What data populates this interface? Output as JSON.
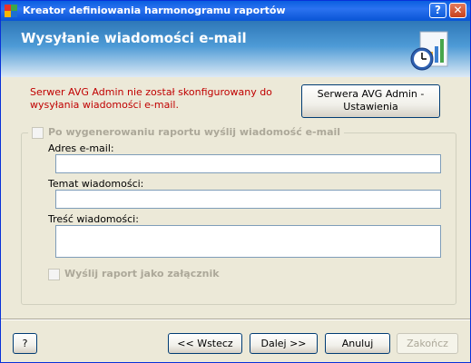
{
  "window": {
    "title": "Kreator definiowania harmonogramu raportów",
    "help_button": "?",
    "close_button": "✕"
  },
  "banner": {
    "title": "Wysyłanie wiadomości e-mail",
    "icon": "clock-chart-icon"
  },
  "warning": {
    "text": "Serwer AVG Admin nie został skonfigurowany do wysyłania wiadomości e-mail."
  },
  "settings_button": {
    "line1": "Serwera AVG Admin -",
    "line2": "Ustawienia"
  },
  "email_group": {
    "checkbox_label": "Po wygenerowaniu raportu wyślij wiadomość e-mail",
    "checked": false,
    "address_label": "Adres e-mail:",
    "address_value": "",
    "subject_label": "Temat wiadomości:",
    "subject_value": "",
    "body_label": "Treść wiadomości:",
    "body_value": "",
    "attach_label": "Wyślij raport jako załącznik",
    "attach_checked": false
  },
  "footer": {
    "help": "?",
    "back": "<< Wstecz",
    "next": "Dalej >>",
    "cancel": "Anuluj",
    "finish": "Zakończ"
  },
  "colors": {
    "warning": "#C00000",
    "titlebar": "#0A5FE0"
  }
}
